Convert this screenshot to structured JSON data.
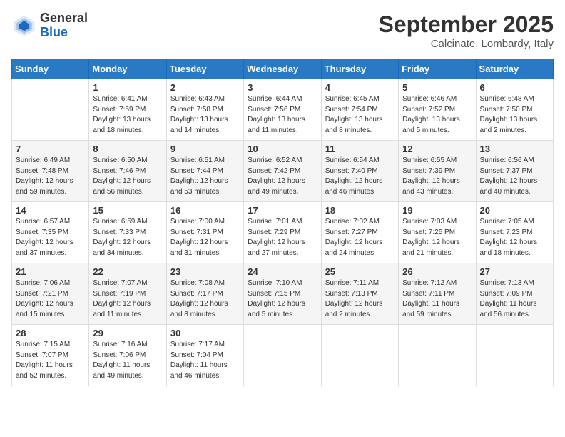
{
  "logo": {
    "general": "General",
    "blue": "Blue"
  },
  "title": {
    "month_year": "September 2025",
    "location": "Calcinate, Lombardy, Italy"
  },
  "headers": [
    "Sunday",
    "Monday",
    "Tuesday",
    "Wednesday",
    "Thursday",
    "Friday",
    "Saturday"
  ],
  "weeks": [
    [
      {
        "day": "",
        "info": ""
      },
      {
        "day": "1",
        "info": "Sunrise: 6:41 AM\nSunset: 7:59 PM\nDaylight: 13 hours\nand 18 minutes."
      },
      {
        "day": "2",
        "info": "Sunrise: 6:43 AM\nSunset: 7:58 PM\nDaylight: 13 hours\nand 14 minutes."
      },
      {
        "day": "3",
        "info": "Sunrise: 6:44 AM\nSunset: 7:56 PM\nDaylight: 13 hours\nand 11 minutes."
      },
      {
        "day": "4",
        "info": "Sunrise: 6:45 AM\nSunset: 7:54 PM\nDaylight: 13 hours\nand 8 minutes."
      },
      {
        "day": "5",
        "info": "Sunrise: 6:46 AM\nSunset: 7:52 PM\nDaylight: 13 hours\nand 5 minutes."
      },
      {
        "day": "6",
        "info": "Sunrise: 6:48 AM\nSunset: 7:50 PM\nDaylight: 13 hours\nand 2 minutes."
      }
    ],
    [
      {
        "day": "7",
        "info": "Sunrise: 6:49 AM\nSunset: 7:48 PM\nDaylight: 12 hours\nand 59 minutes."
      },
      {
        "day": "8",
        "info": "Sunrise: 6:50 AM\nSunset: 7:46 PM\nDaylight: 12 hours\nand 56 minutes."
      },
      {
        "day": "9",
        "info": "Sunrise: 6:51 AM\nSunset: 7:44 PM\nDaylight: 12 hours\nand 53 minutes."
      },
      {
        "day": "10",
        "info": "Sunrise: 6:52 AM\nSunset: 7:42 PM\nDaylight: 12 hours\nand 49 minutes."
      },
      {
        "day": "11",
        "info": "Sunrise: 6:54 AM\nSunset: 7:40 PM\nDaylight: 12 hours\nand 46 minutes."
      },
      {
        "day": "12",
        "info": "Sunrise: 6:55 AM\nSunset: 7:39 PM\nDaylight: 12 hours\nand 43 minutes."
      },
      {
        "day": "13",
        "info": "Sunrise: 6:56 AM\nSunset: 7:37 PM\nDaylight: 12 hours\nand 40 minutes."
      }
    ],
    [
      {
        "day": "14",
        "info": "Sunrise: 6:57 AM\nSunset: 7:35 PM\nDaylight: 12 hours\nand 37 minutes."
      },
      {
        "day": "15",
        "info": "Sunrise: 6:59 AM\nSunset: 7:33 PM\nDaylight: 12 hours\nand 34 minutes."
      },
      {
        "day": "16",
        "info": "Sunrise: 7:00 AM\nSunset: 7:31 PM\nDaylight: 12 hours\nand 31 minutes."
      },
      {
        "day": "17",
        "info": "Sunrise: 7:01 AM\nSunset: 7:29 PM\nDaylight: 12 hours\nand 27 minutes."
      },
      {
        "day": "18",
        "info": "Sunrise: 7:02 AM\nSunset: 7:27 PM\nDaylight: 12 hours\nand 24 minutes."
      },
      {
        "day": "19",
        "info": "Sunrise: 7:03 AM\nSunset: 7:25 PM\nDaylight: 12 hours\nand 21 minutes."
      },
      {
        "day": "20",
        "info": "Sunrise: 7:05 AM\nSunset: 7:23 PM\nDaylight: 12 hours\nand 18 minutes."
      }
    ],
    [
      {
        "day": "21",
        "info": "Sunrise: 7:06 AM\nSunset: 7:21 PM\nDaylight: 12 hours\nand 15 minutes."
      },
      {
        "day": "22",
        "info": "Sunrise: 7:07 AM\nSunset: 7:19 PM\nDaylight: 12 hours\nand 11 minutes."
      },
      {
        "day": "23",
        "info": "Sunrise: 7:08 AM\nSunset: 7:17 PM\nDaylight: 12 hours\nand 8 minutes."
      },
      {
        "day": "24",
        "info": "Sunrise: 7:10 AM\nSunset: 7:15 PM\nDaylight: 12 hours\nand 5 minutes."
      },
      {
        "day": "25",
        "info": "Sunrise: 7:11 AM\nSunset: 7:13 PM\nDaylight: 12 hours\nand 2 minutes."
      },
      {
        "day": "26",
        "info": "Sunrise: 7:12 AM\nSunset: 7:11 PM\nDaylight: 11 hours\nand 59 minutes."
      },
      {
        "day": "27",
        "info": "Sunrise: 7:13 AM\nSunset: 7:09 PM\nDaylight: 11 hours\nand 56 minutes."
      }
    ],
    [
      {
        "day": "28",
        "info": "Sunrise: 7:15 AM\nSunset: 7:07 PM\nDaylight: 11 hours\nand 52 minutes."
      },
      {
        "day": "29",
        "info": "Sunrise: 7:16 AM\nSunset: 7:06 PM\nDaylight: 11 hours\nand 49 minutes."
      },
      {
        "day": "30",
        "info": "Sunrise: 7:17 AM\nSunset: 7:04 PM\nDaylight: 11 hours\nand 46 minutes."
      },
      {
        "day": "",
        "info": ""
      },
      {
        "day": "",
        "info": ""
      },
      {
        "day": "",
        "info": ""
      },
      {
        "day": "",
        "info": ""
      }
    ]
  ]
}
